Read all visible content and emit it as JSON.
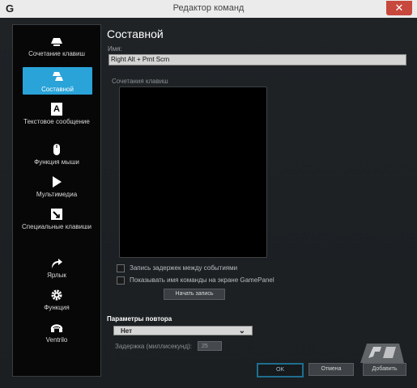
{
  "window": {
    "app_icon_name": "logitech-g-icon",
    "title": "Редактор команд",
    "close_glyph": "✕"
  },
  "sidebar": {
    "items": [
      {
        "label": "Сочетание клавиш",
        "icon": "keystroke-icon"
      },
      {
        "label": "Составной",
        "icon": "multikey-icon",
        "active": true
      },
      {
        "label": "Текстовое сообщение",
        "icon": "text-icon",
        "glyph": "A"
      },
      {
        "label": "Функция мыши",
        "icon": "mouse-icon"
      },
      {
        "label": "Мультимедиа",
        "icon": "play-icon"
      },
      {
        "label": "Специальные клавиши",
        "icon": "special-key-icon"
      },
      {
        "label": "Ярлык",
        "icon": "shortcut-arrow-icon"
      },
      {
        "label": "Функция",
        "icon": "function-gear-icon"
      },
      {
        "label": "Ventrilo",
        "icon": "headset-icon"
      }
    ]
  },
  "main": {
    "title": "Составной",
    "name_label": "Имя:",
    "name_value": "Right Alt + Prnt Scrn",
    "keys_label": "Сочетания клавиш",
    "checkbox_delays": "Запись задержек между событиями",
    "checkbox_gamepanel": "Показывать имя команды на экране GamePanel",
    "record_button": "Начать запись",
    "repeat_label": "Параметры повтора",
    "repeat_value": "Нет",
    "delay_label": "Задержка (миллисекунд):",
    "delay_value": "25"
  },
  "buttons": {
    "ok": "OK",
    "cancel": "Отмена",
    "add": "Добавить"
  },
  "colors": {
    "accent": "#29a3d8",
    "background": "#1c2023",
    "sidebar": "#070707"
  }
}
